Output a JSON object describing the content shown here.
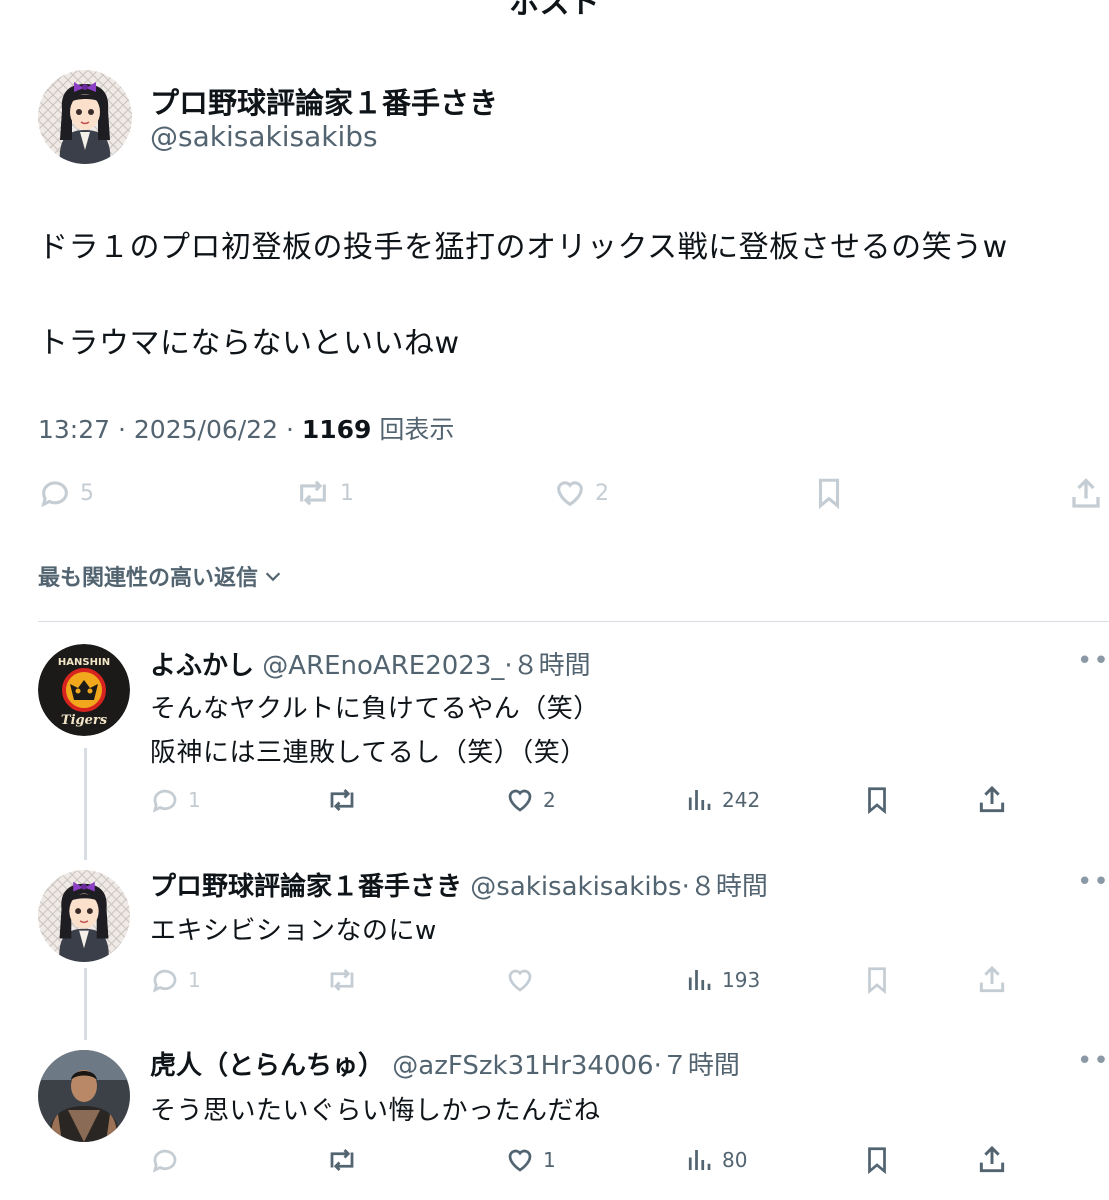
{
  "header": {
    "title": "ポスト"
  },
  "post": {
    "author_name": "プロ野球評論家１番手さき",
    "author_handle": "@sakisakisakibs",
    "text_line1": "ドラ１のプロ初登板の投手を猛打のオリックス戦に登板させるの笑うw",
    "text_line2": "トラウマにならないといいねw",
    "time": "13:27",
    "separator": "·",
    "date": "2025/06/22",
    "views_count": "1169",
    "views_label": "回表示",
    "replies": "5",
    "reposts": "1",
    "likes": "2"
  },
  "sort_label": "最も関連性の高い返信",
  "replies": [
    {
      "name": "よふかし",
      "handle": "@AREnoARE2023_",
      "time": "·８時間",
      "line1": "そんなヤクルトに負けてるやん（笑）",
      "line2": "阪神には三連敗してるし（笑）（笑）",
      "reply_count": "1",
      "like_count": "2",
      "view_count": "242",
      "avatar_badge_top": "HANSHIN",
      "avatar_badge_bottom": "Tigers"
    },
    {
      "name": "プロ野球評論家１番手さき",
      "handle": "@sakisakisakibs",
      "time": "·８時間",
      "line1": "エキシビションなのにw",
      "reply_count": "1",
      "view_count": "193"
    },
    {
      "name": "虎人（とらんちゅ）",
      "handle": "@azFSzk31Hr34006",
      "time": "·７時間",
      "line1": "そう思いたいぐらい悔しかったんだね",
      "like_count": "1",
      "view_count": "80"
    }
  ],
  "colors": {
    "text": "#0f1419",
    "muted": "#536471",
    "faded": "#c5cdd4",
    "divider": "#d7dde2"
  }
}
